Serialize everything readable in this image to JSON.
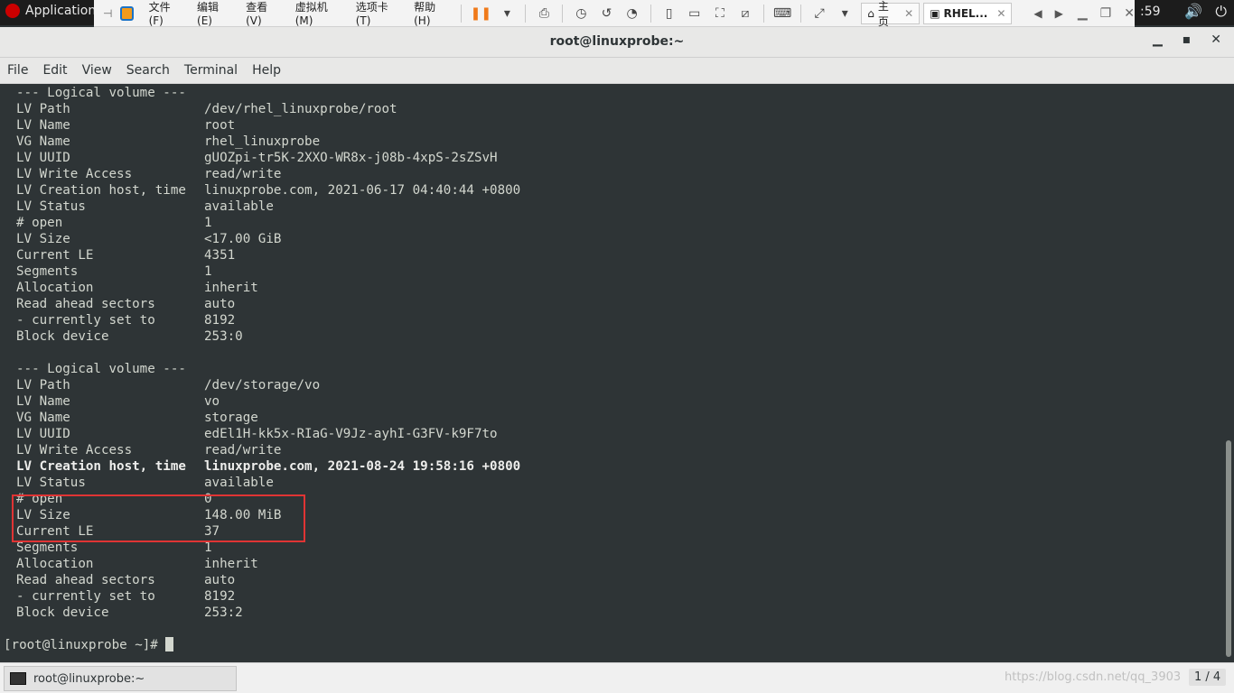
{
  "topbar": {
    "applications": "Application",
    "clock": ":59",
    "volume_icon": "volume-icon",
    "power_icon": "power-icon"
  },
  "vmware": {
    "menu": [
      "文件(F)",
      "编辑(E)",
      "查看(V)",
      "虚拟机(M)",
      "选项卡(T)",
      "帮助(H)"
    ],
    "tab_home": "主页",
    "tab_vm": "RHEL..."
  },
  "window": {
    "title": "root@linuxprobe:~"
  },
  "menubar": [
    "File",
    "Edit",
    "View",
    "Search",
    "Terminal",
    "Help"
  ],
  "terminal": {
    "blocks": [
      {
        "header": "  --- Logical volume ---",
        "rows": [
          [
            "LV Path",
            "/dev/rhel_linuxprobe/root"
          ],
          [
            "LV Name",
            "root"
          ],
          [
            "VG Name",
            "rhel_linuxprobe"
          ],
          [
            "LV UUID",
            "gUOZpi-tr5K-2XXO-WR8x-j08b-4xpS-2sZSvH"
          ],
          [
            "LV Write Access",
            "read/write"
          ],
          [
            "LV Creation host, time",
            "linuxprobe.com, 2021-06-17 04:40:44 +0800"
          ],
          [
            "LV Status",
            "available"
          ],
          [
            "# open",
            "1"
          ],
          [
            "LV Size",
            "<17.00 GiB"
          ],
          [
            "Current LE",
            "4351"
          ],
          [
            "Segments",
            "1"
          ],
          [
            "Allocation",
            "inherit"
          ],
          [
            "Read ahead sectors",
            "auto"
          ],
          [
            "- currently set to",
            "8192"
          ],
          [
            "Block device",
            "253:0"
          ]
        ]
      },
      {
        "header": "  --- Logical volume ---",
        "rows": [
          [
            "LV Path",
            "/dev/storage/vo"
          ],
          [
            "LV Name",
            "vo"
          ],
          [
            "VG Name",
            "storage"
          ],
          [
            "LV UUID",
            "edEl1H-kk5x-RIaG-V9Jz-ayhI-G3FV-k9F7to"
          ],
          [
            "LV Write Access",
            "read/write"
          ],
          [
            "LV Creation host, time",
            "linuxprobe.com, 2021-08-24 19:58:16 +0800"
          ],
          [
            "LV Status",
            "available"
          ],
          [
            "# open",
            "0"
          ],
          [
            "LV Size",
            "148.00 MiB"
          ],
          [
            "Current LE",
            "37"
          ],
          [
            "Segments",
            "1"
          ],
          [
            "Allocation",
            "inherit"
          ],
          [
            "Read ahead sectors",
            "auto"
          ],
          [
            "- currently set to",
            "8192"
          ],
          [
            "Block device",
            "253:2"
          ]
        ]
      }
    ],
    "prompt": "[root@linuxprobe ~]# "
  },
  "taskbar": {
    "task_label": "root@linuxprobe:~",
    "watermark": "https://blog.csdn.net/qq_3903",
    "pager": "1 / 4"
  }
}
